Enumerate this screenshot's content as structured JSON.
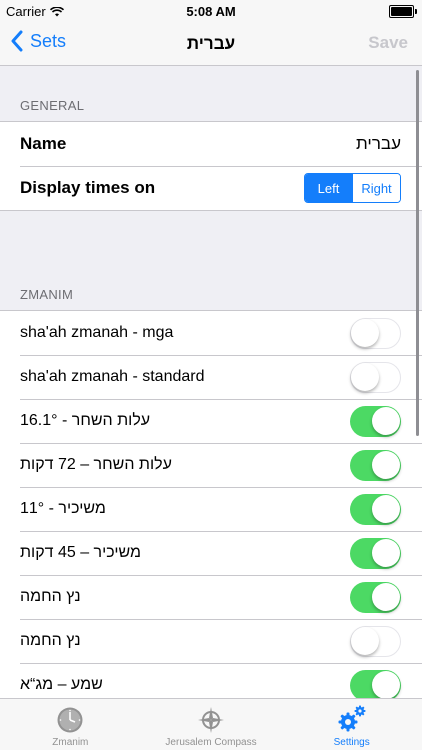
{
  "status": {
    "carrier": "Carrier",
    "time": "5:08 AM",
    "battery": 1.0
  },
  "nav": {
    "back": "Sets",
    "title": "עברית",
    "save": "Save"
  },
  "general": {
    "header": "GENERAL",
    "name_label": "Name",
    "name_value": "עברית",
    "display_label": "Display times on",
    "seg_left": "Left",
    "seg_right": "Right",
    "selected": "Left"
  },
  "zmanim": {
    "header": "ZMANIM",
    "items": [
      {
        "label": "sha'ah zmanah - mga",
        "on": false
      },
      {
        "label": "sha'ah zmanah - standard",
        "on": false
      },
      {
        "label": "עלות השחר - 16.1°",
        "on": true
      },
      {
        "label": "עלות השחר – 72 דקות",
        "on": true
      },
      {
        "label": "משיכיר - 11°",
        "on": true
      },
      {
        "label": "משיכיר – 45 דקות",
        "on": true
      },
      {
        "label": "נץ החמה",
        "on": true
      },
      {
        "label": "נץ החמה",
        "on": false
      },
      {
        "label": "שמע – מג“א",
        "on": true
      }
    ]
  },
  "tabs": [
    {
      "label": "Zmanim",
      "icon": "clock-icon",
      "active": false
    },
    {
      "label": "Jerusalem Compass",
      "icon": "compass-icon",
      "active": false
    },
    {
      "label": "Settings",
      "icon": "gears-icon",
      "active": true
    }
  ],
  "colors": {
    "accent": "#147efb",
    "switch_on": "#4cd964",
    "disabled": "#c7c7cc"
  }
}
